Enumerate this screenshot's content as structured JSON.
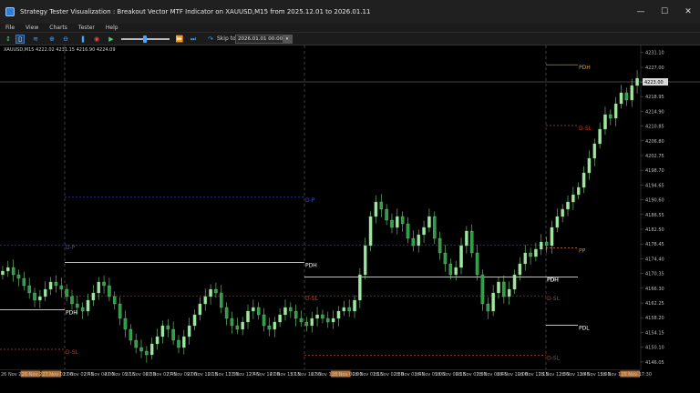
{
  "window": {
    "title": "Strategy Tester Visualization : Breakout Vector MTF Indicator on XAUUSD,M15 from 2025.12.01 to 2026.01.11",
    "minimize_icon": "minimize-icon",
    "maximize_icon": "maximize-icon",
    "close_icon": "close-icon"
  },
  "menu": {
    "items": [
      "File",
      "View",
      "Charts",
      "Tester",
      "Help"
    ]
  },
  "toolbar": {
    "skip_to_label": "Skip to",
    "date_value": "2026.01.01 00:00",
    "icons": [
      "bar-chart-icon",
      "candlestick-icon",
      "line-chart-icon",
      "zoom-in-icon",
      "zoom-out-icon",
      "pause-icon",
      "stop-icon",
      "play-icon",
      "speed-slider-icon",
      "fast-forward-icon",
      "step-forward-icon",
      "skip-to-icon"
    ],
    "speed_level": 0.45
  },
  "chart_header": {
    "text": "XAUUSD,M15  4222.02  4231.15  4216.90  4224.09"
  },
  "price_axis": {
    "ticks": [
      "4231.10",
      "4227.00",
      "4222.90",
      "4218.95",
      "4214.90",
      "4210.85",
      "4206.80",
      "4202.75",
      "4198.70",
      "4194.65",
      "4190.60",
      "4186.55",
      "4182.50",
      "4178.45",
      "4174.40",
      "4170.35",
      "4166.30",
      "4162.25",
      "4158.20",
      "4154.15",
      "4150.10",
      "4146.05"
    ],
    "current_price": "4223.00"
  },
  "time_axis": {
    "labels": [
      "26 Nov 2025",
      "26 Nov 23:45",
      "27 Nov 01:00",
      "27 Nov 02:45",
      "27 Nov 04:00",
      "27 Nov 05:15",
      "27 Nov 06:30",
      "27 Nov 07:45",
      "27 Nov 09:00",
      "27 Nov 10:15",
      "27 Nov 11:30",
      "27 Nov 12:45",
      "27 Nov 14:00",
      "27 Nov 15:15",
      "27 Nov 16:30",
      "27 Nov 17:45",
      "28 Nov 00:00",
      "28 Nov 01:15",
      "28 Nov 02:30",
      "28 Nov 03:45",
      "28 Nov 05:00",
      "28 Nov 06:15",
      "28 Nov 07:30",
      "28 Nov 08:45",
      "28 Nov 10:00",
      "28 Nov 11:15",
      "28 Nov 12:30",
      "28 Nov 13:45",
      "28 Nov 15:00",
      "28 Nov 16:15",
      "28 Nov 17:30"
    ],
    "highlight_labels": [
      "26 Nov 23:45",
      "27 Nov 01:00",
      "28 Nov 00:00",
      "28 Nov 17:30"
    ]
  },
  "levels": [
    {
      "label": "PDH",
      "color": "#ffffff"
    },
    {
      "label": "D-SL",
      "color": "#c0392b"
    },
    {
      "label": "D-P",
      "color": "#2f4fd6"
    },
    {
      "label": "PDH",
      "color": "#ffffff"
    },
    {
      "label": "PDL",
      "color": "#ffffff"
    },
    {
      "label": "D-SL",
      "color": "#c0392b"
    },
    {
      "label": "D-P",
      "color": "#2f4fd6"
    },
    {
      "label": "PDH",
      "color": "#ffffff"
    },
    {
      "label": "PDL",
      "color": "#ffffff"
    },
    {
      "label": "PP",
      "color": "#e67e22"
    }
  ],
  "colors": {
    "bull": "#9fe6a0",
    "bear": "#2e9e47",
    "wick": "#7ccf7f",
    "grid": "#303030",
    "separator": "#6b6b6b",
    "axis_bg": "#000000",
    "highlight_bg": "#b87333"
  },
  "chart_data": {
    "type": "candlestick",
    "symbol": "XAUUSD",
    "timeframe": "M15",
    "ylim": [
      4144,
      4233
    ],
    "closes": [
      4171,
      4172,
      4170,
      4169,
      4167,
      4165,
      4163,
      4164,
      4166,
      4168,
      4167,
      4166,
      4164,
      4162,
      4161,
      4160,
      4163,
      4165,
      4168,
      4167,
      4164,
      4162,
      4158,
      4155,
      4152,
      4150,
      4149,
      4148,
      4151,
      4153,
      4156,
      4155,
      4152,
      4150,
      4153,
      4156,
      4159,
      4162,
      4164,
      4166,
      4165,
      4161,
      4158,
      4156,
      4155,
      4157,
      4160,
      4161,
      4159,
      4156,
      4155,
      4157,
      4159,
      4161,
      4160,
      4158,
      4157,
      4156,
      4158,
      4159,
      4158,
      4157,
      4158,
      4160,
      4161,
      4160,
      4163,
      4170,
      4178,
      4186,
      4190,
      4188,
      4185,
      4183,
      4186,
      4184,
      4180,
      4178,
      4181,
      4183,
      4186,
      4180,
      4176,
      4173,
      4170,
      4172,
      4178,
      4182,
      4176,
      4170,
      4162,
      4160,
      4165,
      4168,
      4164,
      4166,
      4170,
      4173,
      4176,
      4175,
      4177,
      4179,
      4178,
      4183,
      4186,
      4188,
      4190,
      4192,
      4194,
      4198,
      4202,
      4206,
      4210,
      4214,
      4213,
      4217,
      4220,
      4218,
      4222,
      4224
    ]
  },
  "level_price": {
    "d_sl_left": 4149.5,
    "pdh_left": 4160.4,
    "d_p_left_blue": 4178.2,
    "d_p_mid_blue": 4191.3,
    "pdh_mid": 4173.4,
    "pdh_right": 4169.4,
    "d_sl_mid": 4164.2,
    "pp_right": 4177.4,
    "d_sl_right_low": 4147.9,
    "d_sl_right_top": 4211.0,
    "pdh_top": 4227.7,
    "pdl_right": 4156.1
  }
}
